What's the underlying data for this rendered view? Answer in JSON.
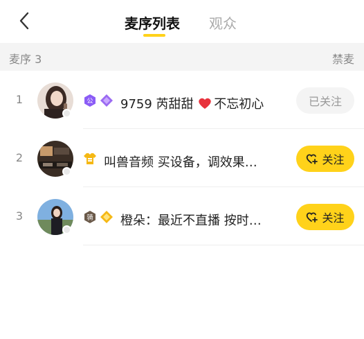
{
  "header": {
    "tabs": [
      {
        "label": "麦序列表",
        "active": true
      },
      {
        "label": "观众",
        "active": false
      }
    ],
    "accent_color": "#ffd21a"
  },
  "queue_bar": {
    "title": "麦序 3",
    "mute_label": "禁麦"
  },
  "rows": [
    {
      "index": "1",
      "name_prefix": "9759 芮甜甜",
      "name_suffix": "不忘初心",
      "badges": [
        "guild-badge-icon",
        "level-diamond-icon"
      ],
      "inline_icon": "red-heart-icon",
      "button_label": "已关注",
      "followed": true
    },
    {
      "index": "2",
      "name": "叫兽音频 买设备，调效果…",
      "badges": [
        "level-shirt-icon"
      ],
      "button_label": "关注",
      "followed": false
    },
    {
      "index": "3",
      "name": "橙朵：最近不直播 按时…",
      "badges": [
        "knight-badge-icon",
        "level-gem-icon"
      ],
      "button_label": "关注",
      "followed": false
    }
  ]
}
